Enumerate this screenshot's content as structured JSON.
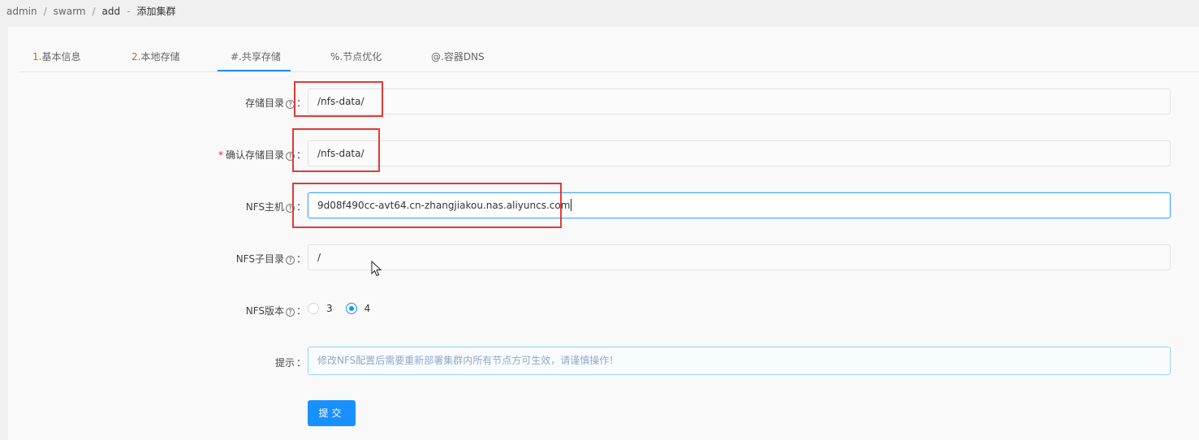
{
  "breadcrumb": {
    "items": [
      "admin",
      "swarm",
      "add"
    ],
    "separator": "/",
    "title_sep": "-",
    "current": "添加集群"
  },
  "tabs": [
    {
      "num": "1.",
      "label": "基本信息"
    },
    {
      "num": "2.",
      "label": "本地存储"
    },
    {
      "num": "#.",
      "label": "共享存储"
    },
    {
      "num": "%.",
      "label": "节点优化"
    },
    {
      "num": "@.",
      "label": "容器DNS"
    }
  ],
  "active_tab_index": 2,
  "form": {
    "storage_dir": {
      "label": "存储目录",
      "value": "/nfs-data/"
    },
    "confirm_storage_dir": {
      "label": "确认存储目录",
      "required_mark": "*",
      "value": "/nfs-data/"
    },
    "nfs_host": {
      "label": "NFS主机",
      "value": "9d08f490cc-avt64.cn-zhangjiakou.nas.aliyuncs.com"
    },
    "nfs_subdir": {
      "label": "NFS子目录",
      "value": "/"
    },
    "nfs_version": {
      "label": "NFS版本",
      "options": [
        "3",
        "4"
      ],
      "selected": "4"
    },
    "tip": {
      "label": "提示",
      "text": "修改NFS配置后需要重新部署集群内所有节点方可生效，请谨慎操作！"
    },
    "help_glyph": "?",
    "colon": "："
  },
  "submit_label": "提交",
  "colors": {
    "accent": "#1890ff",
    "tab_num": "#d46b08",
    "highlight": "#e53935"
  }
}
